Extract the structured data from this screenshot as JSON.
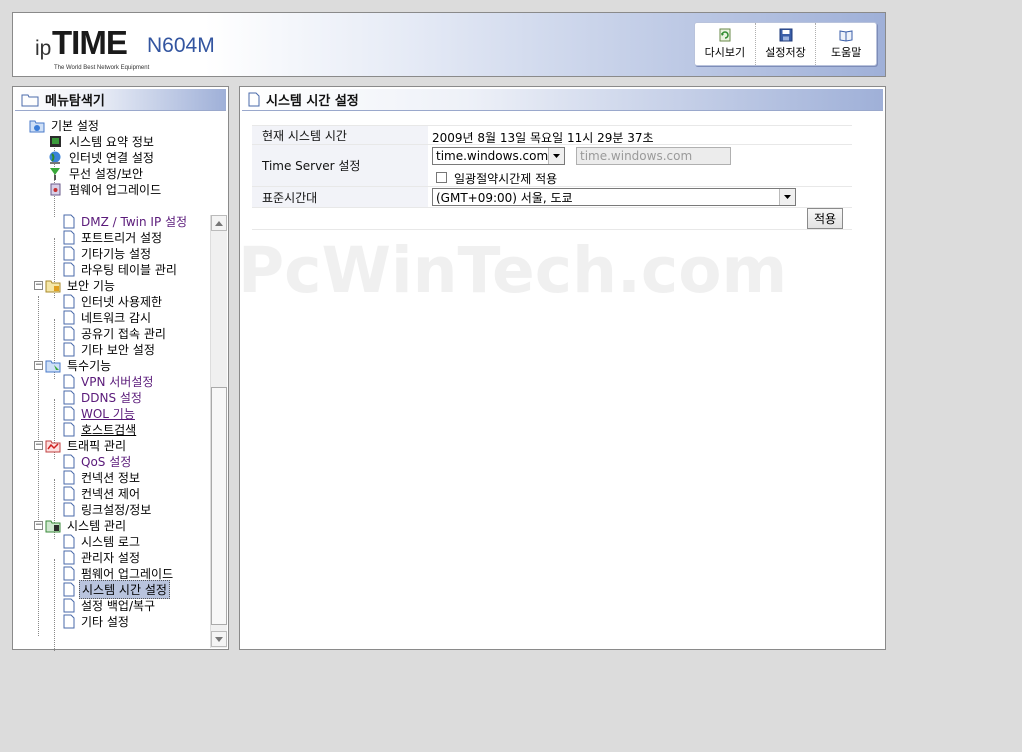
{
  "header": {
    "logo_ip": "ip",
    "logo_time": "TIME",
    "logo_model": "N604M",
    "logo_tagline": "The World Best Network Equipment",
    "buttons": [
      {
        "label": "다시보기",
        "icon": "refresh-icon"
      },
      {
        "label": "설정저장",
        "icon": "save-icon"
      },
      {
        "label": "도움말",
        "icon": "help-book-icon"
      }
    ]
  },
  "sidebar": {
    "title": "메뉴탐색기",
    "groups": [
      {
        "label": "기본 설정",
        "items": [
          "시스템 요약 정보",
          "인터넷 연결 설정",
          "무선 설정/보안",
          "펌웨어 업그레이드"
        ]
      },
      {
        "label": "",
        "items": [
          "DMZ / Twin IP 설정",
          "포트트리거 설정",
          "기타기능 설정",
          "라우팅 테이블 관리"
        ]
      },
      {
        "label": "보안 기능",
        "items": [
          "인터넷 사용제한",
          "네트워크 감시",
          "공유기 접속 관리",
          "기타 보안 설정"
        ]
      },
      {
        "label": "특수기능",
        "items": [
          "VPN 서버설정",
          "DDNS 설정",
          "WOL 기능",
          "호스트검색"
        ]
      },
      {
        "label": "트래픽 관리",
        "items": [
          "QoS 설정",
          "컨넥션 정보",
          "컨넥션 제어",
          "링크설정/정보"
        ]
      },
      {
        "label": "시스템 관리",
        "items": [
          "시스템 로그",
          "관리자 설정",
          "펌웨어 업그레이드",
          "시스템 시간 설정",
          "설정 백업/복구",
          "기타 설정"
        ]
      }
    ],
    "selected": "시스템 시간 설정"
  },
  "main": {
    "title": "시스템 시간 설정",
    "rows": {
      "current_time_label": "현재 시스템 시간",
      "current_time_value": "2009년 8월 13일 목요일 11시 29분 37초",
      "time_server_label": "Time Server 설정",
      "time_server_selected": "time.windows.com",
      "time_server_text": "time.windows.com",
      "dst_label": "일광절약시간제 적용",
      "dst_checked": false,
      "timezone_label": "표준시간대",
      "timezone_selected": "(GMT+09:00) 서울, 도쿄"
    },
    "apply_label": "적용"
  },
  "watermark": "PcWinTech.com",
  "colors": {
    "background": "#dcdcdc",
    "header_gradient_end": "#9fb0d8",
    "label_cell": "#f2f3f8",
    "selection": "#b9c4de",
    "logo_model": "#3355a0"
  }
}
